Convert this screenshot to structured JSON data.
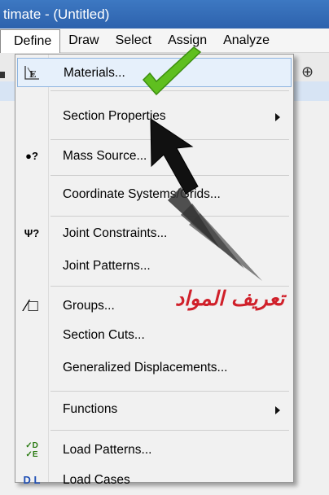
{
  "window": {
    "title": "timate  - (Untitled)"
  },
  "menubar": {
    "items": [
      {
        "label": "Define",
        "active": true
      },
      {
        "label": "Draw"
      },
      {
        "label": "Select"
      },
      {
        "label": "Assign"
      },
      {
        "label": "Analyze"
      }
    ]
  },
  "dropdown": {
    "items": [
      {
        "label": "Materials...",
        "icon": "materials-icon",
        "highlighted": true
      },
      {
        "label": "Section Properties",
        "submenu": true
      },
      {
        "label": "Mass Source...",
        "icon": "mass-source-icon"
      },
      {
        "label": "Coordinate Systems/Grids..."
      },
      {
        "label": "Joint Constraints...",
        "icon": "joint-constraints-icon"
      },
      {
        "label": "Joint Patterns..."
      },
      {
        "label": "Groups...",
        "icon": "groups-icon"
      },
      {
        "label": "Section Cuts..."
      },
      {
        "label": "Generalized Displacements..."
      },
      {
        "label": "Functions",
        "submenu": true
      },
      {
        "label": "Load Patterns...",
        "icon": "load-patterns-icon"
      },
      {
        "label": "Load Cases",
        "icon": "load-cases-icon"
      }
    ]
  },
  "icons": {
    "mass_glyph": "●?",
    "joint_glyph": "Ψ?",
    "groups_glyph": "⁄□",
    "loadpat_glyph": "✓D ✓E",
    "loadcase_glyph": "D L"
  },
  "annotation": {
    "text": "تعريف المواد",
    "color": "#d0202a"
  },
  "colors": {
    "titlebar": "#2d62ad",
    "highlight": "#e6f0fb",
    "check": "#5fbf1f"
  }
}
